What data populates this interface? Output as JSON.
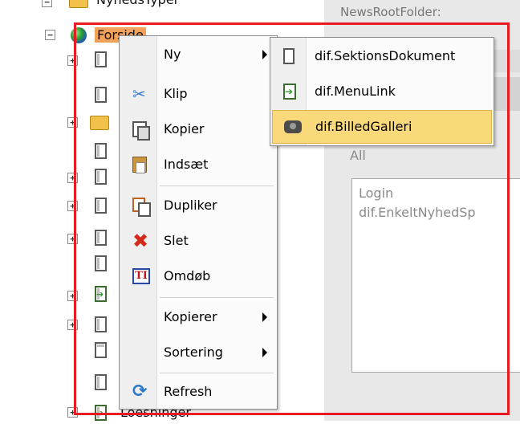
{
  "tree": {
    "top_partial_label": "NyhedsTyper",
    "forside_label": "Forside",
    "bottom_partial_label": "Loesninger"
  },
  "right_pane": {
    "partial_header": "NewsRootFolder:",
    "filter_label": "All",
    "list_items": [
      "Login",
      "dif.EnkeltNyhedSp"
    ]
  },
  "context_menu": {
    "items": [
      {
        "label": "Ny",
        "icon": "blank-icon",
        "submenu": true
      },
      {
        "label": "Klip",
        "icon": "scissors-icon",
        "submenu": false
      },
      {
        "label": "Kopier",
        "icon": "copy-icon",
        "submenu": false
      },
      {
        "label": "Indsæt",
        "icon": "paste-icon",
        "submenu": false
      },
      {
        "label": "Dupliker",
        "icon": "duplicate-icon",
        "submenu": false
      },
      {
        "label": "Slet",
        "icon": "delete-x-icon",
        "submenu": false
      },
      {
        "label": "Omdøb",
        "icon": "rename-icon",
        "submenu": false
      },
      {
        "label": "Kopierer",
        "icon": "blank-icon",
        "submenu": true
      },
      {
        "label": "Sortering",
        "icon": "blank-icon",
        "submenu": true
      },
      {
        "label": "Refresh",
        "icon": "refresh-icon",
        "submenu": false
      }
    ]
  },
  "submenu_ny": {
    "items": [
      {
        "label": "dif.SektionsDokument",
        "icon": "document-icon"
      },
      {
        "label": "dif.MenuLink",
        "icon": "menu-link-icon"
      },
      {
        "label": "dif.BilledGalleri",
        "icon": "gallery-icon",
        "highlighted": true
      }
    ]
  },
  "colors": {
    "highlight": "#f9d97a",
    "selection_bg": "#f4a25a",
    "annotation_frame": "#e81b22"
  }
}
